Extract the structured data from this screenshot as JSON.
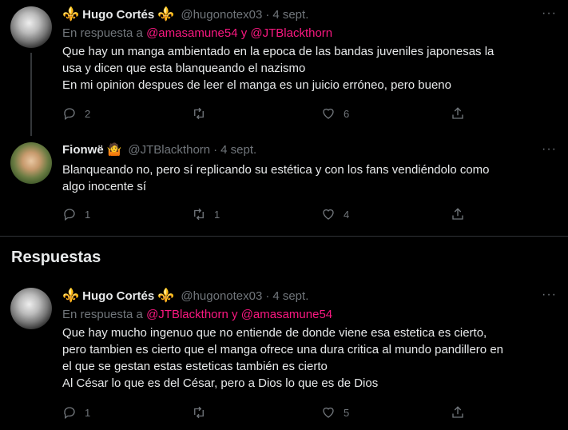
{
  "tweets": [
    {
      "name": "Hugo Cortés",
      "name_prefix": "⚜️",
      "name_suffix": "⚜️",
      "handle": "@hugonotex03",
      "date": "4 sept.",
      "reply_prefix": "En respuesta a",
      "reply_mention1": "@amasamune54",
      "reply_join": "y",
      "reply_mention2": "@JTBlackthorn",
      "lines": [
        "Que hay un manga ambientado en la epoca de las bandas juveniles japonesas la",
        "usa y dicen que esta blanqueando el nazismo",
        "En mi opinion despues de leer el manga es un juicio erróneo, pero bueno"
      ],
      "replies": "2",
      "retweets": "",
      "likes": "6"
    },
    {
      "name": "Fionwë",
      "name_suffix": "🤷",
      "handle": "@JTBlackthorn",
      "date": "4 sept.",
      "lines": [
        "Blanqueando no, pero sí replicando su estética y con los fans vendiéndolo como",
        "algo inocente sí"
      ],
      "replies": "1",
      "retweets": "1",
      "likes": "4"
    },
    {
      "name": "Hugo Cortés",
      "name_prefix": "⚜️",
      "name_suffix": "⚜️",
      "handle": "@hugonotex03",
      "date": "4 sept.",
      "reply_prefix": "En respuesta a",
      "reply_mention1": "@JTBlackthorn",
      "reply_join": "y",
      "reply_mention2": "@amasamune54",
      "lines": [
        "Que hay mucho ingenuo que no entiende de donde viene esa estetica es cierto,",
        "pero tambien es cierto que el manga ofrece una dura critica al mundo pandillero en",
        "el que se gestan estas esteticas también es cierto",
        "Al César lo que es del César, pero a Dios lo que es de Dios"
      ],
      "replies": "1",
      "retweets": "",
      "likes": "5"
    }
  ],
  "section_title": "Respuestas",
  "separator_dot": "·",
  "more_glyph": "···"
}
